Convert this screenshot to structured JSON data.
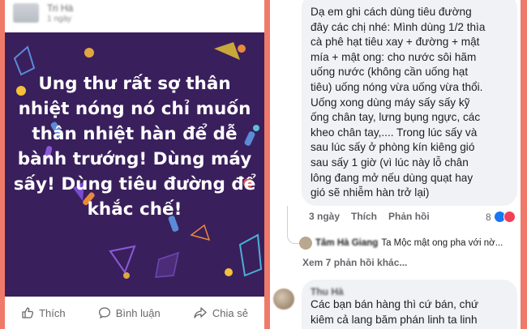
{
  "post": {
    "author_blurred": "Tri Hà",
    "time_blurred": "1 ngày",
    "caption": "Ung thư rất sợ thân nhiệt nóng nó chỉ muốn thân nhiệt hàn để dễ bành trướng! Dùng máy sấy! Dùng tiêu đường để khắc chế!",
    "image_bg_color": "#3a1f5d",
    "actions": {
      "like": "Thích",
      "comment": "Bình luận",
      "share": "Chia sẻ"
    }
  },
  "comment": {
    "text": "Dạ em ghi cách dùng tiêu đường\nđây các chị nhé: Mình dùng 1/2 thìa\ncà phê hạt tiêu xay + đường + mật\nmía + mật ong: cho nước sôi hãm\nuống nước (không cần uống hạt\ntiêu) uống nóng vừa uống vừa thổi.\nUống xong dùng máy sấy sấy kỹ\nống chân tay, lưng bụng ngực, các\nkheo chân tay,.... Trong lúc sấy và\nsau lúc sấy ở phòng kín kiêng gió\nsau sấy 1 giờ (vì lúc này lỗ chân\nlông đang mở nếu dùng quạt hay\ngió sẽ nhiễm hàn trở lại)",
    "time": "3 ngày",
    "like": "Thích",
    "reply": "Phản hồi",
    "reaction_count": "8",
    "reaction_colors": [
      "#1877f2",
      "#f33e58"
    ],
    "reply_preview": {
      "name_blurred": "Tâm Hà Giang",
      "text": "Ta Mộc mật ong pha với nờ..."
    },
    "more_replies": "Xem 7 phản hồi khác..."
  },
  "comment2": {
    "name_blurred": "Thu Hà",
    "text": "Các bạn bán hàng thì cứ bán, chứ\nkiêm cả lang băm phán linh ta linh"
  }
}
